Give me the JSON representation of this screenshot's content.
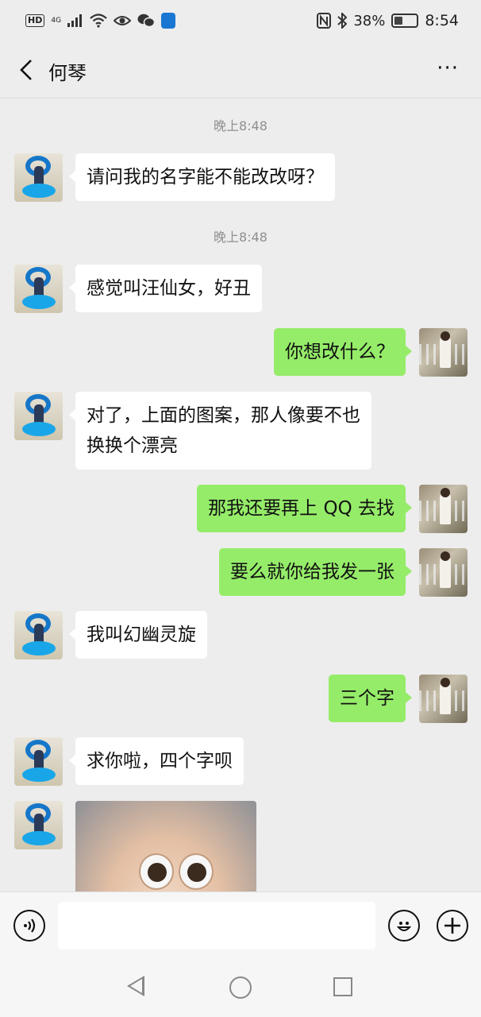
{
  "status_bar": {
    "hd": "HD",
    "network": "4G",
    "battery_pct": "38%",
    "battery_level": 0.38,
    "time": "8:54"
  },
  "header": {
    "title": "何琴",
    "more": "···"
  },
  "messages": [
    {
      "type": "timestamp",
      "text": "晚上8:48"
    },
    {
      "type": "msg",
      "side": "in",
      "text": "请问我的名字能不能改改呀？"
    },
    {
      "type": "timestamp",
      "text": "晚上8:48"
    },
    {
      "type": "msg",
      "side": "in",
      "text": "感觉叫汪仙女，好丑"
    },
    {
      "type": "msg",
      "side": "out",
      "text": "你想改什么？"
    },
    {
      "type": "msg",
      "side": "in",
      "text": "对了，上面的图案，那人像要不也\n换换个漂亮"
    },
    {
      "type": "msg",
      "side": "out",
      "text": "那我还要再上 QQ 去找"
    },
    {
      "type": "msg",
      "side": "out",
      "text": "要么就你给我发一张"
    },
    {
      "type": "msg",
      "side": "in",
      "text": "我叫幻幽灵旋"
    },
    {
      "type": "msg",
      "side": "out",
      "text": "三个字"
    },
    {
      "type": "msg",
      "side": "in",
      "text": "求你啦，四个字呗"
    },
    {
      "type": "image",
      "side": "in",
      "icon": "cartoon-bird-image"
    }
  ],
  "input": {
    "voice_icon": "voice-icon",
    "emoji_icon": "emoji-icon",
    "plus_icon": "plus-icon"
  },
  "colors": {
    "background": "#ededed",
    "incoming_bubble": "#ffffff",
    "outgoing_bubble": "#95ec69"
  }
}
